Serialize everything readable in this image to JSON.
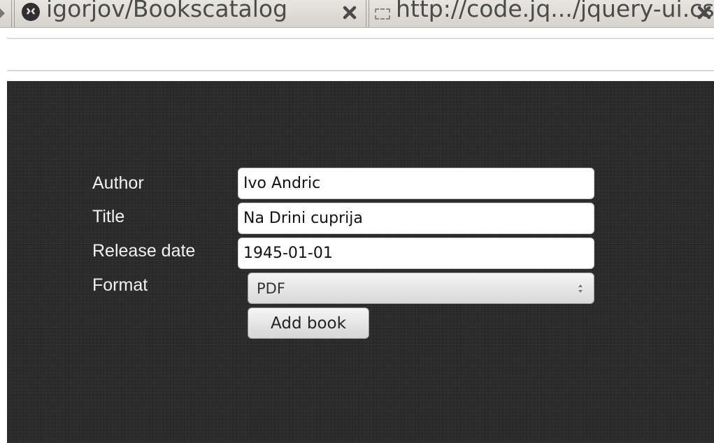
{
  "browser": {
    "tabs": [
      {
        "label": "igorjov/Bookscatalog",
        "icon": "github-icon"
      },
      {
        "label": "http://code.jq.../jquery-ui.css",
        "icon": "page-icon"
      }
    ]
  },
  "form": {
    "author_label": "Author",
    "author_value": "Ivo Andric",
    "title_label": "Title",
    "title_value": "Na Drini cuprija",
    "release_label": "Release date",
    "release_value": "1945-01-01",
    "format_label": "Format",
    "format_selected": "PDF",
    "submit_label": "Add book"
  },
  "colors": {
    "page_background": "#2b2b2b",
    "label_text": "#f2f2f2"
  }
}
